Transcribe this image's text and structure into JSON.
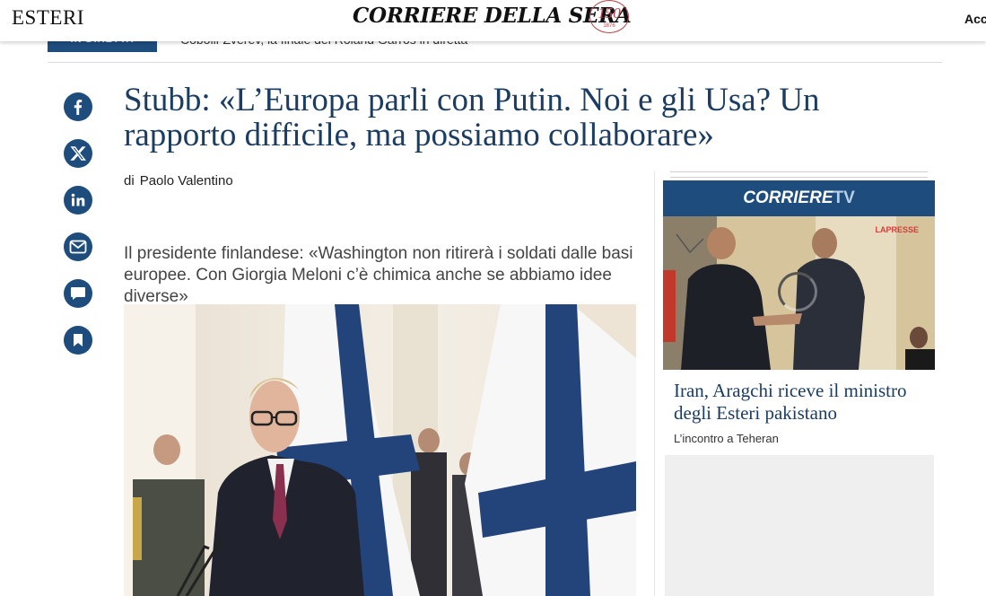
{
  "header": {
    "section": "ESTERI",
    "masthead": "CORRIERE DELLA SERA",
    "anniversary": "150",
    "anniversary_years": "1876",
    "access_label": "Acc"
  },
  "live_strip": {
    "badge": "IN DIRETTA",
    "text": "Cobolli-Zverev, la finale del Roland Garros in diretta"
  },
  "article": {
    "headline": "Stubb: «L’Europa parli con Putin. Noi e gli Usa? Un rapporto difficile, ma possiamo collaborare»",
    "byline_prefix": "di",
    "author": "Paolo Valentino",
    "subtitle": "Il presidente finlandese: «Washington non ritirerà i soldati dalle basi europee. Con Giorgia Meloni c’è chimica anche se abbiamo idee diverse»"
  },
  "social": [
    {
      "icon": "facebook-icon"
    },
    {
      "icon": "x-icon"
    },
    {
      "icon": "linkedin-icon"
    },
    {
      "icon": "email-icon"
    },
    {
      "icon": "comment-icon"
    },
    {
      "icon": "bookmark-icon"
    }
  ],
  "sidebar": {
    "tv_brand": "CORRIERE",
    "tv_suffix": "TV",
    "video_watermark": "LAPRESSE",
    "video_title": "Iran, Aragchi riceve il ministro degli Esteri pakistano",
    "video_subtitle": "L’incontro a Teheran"
  },
  "colors": {
    "brand_blue": "#1e4d7d",
    "headline_blue": "#1b3d62",
    "anniversary_red": "#b8424a"
  }
}
